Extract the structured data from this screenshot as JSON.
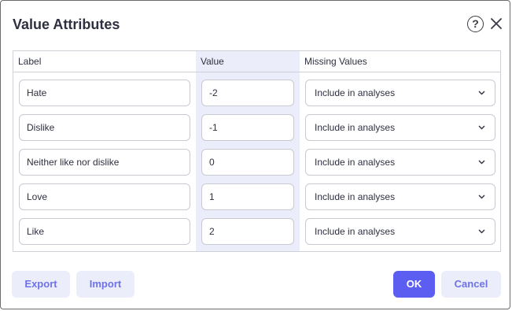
{
  "dialog": {
    "title": "Value Attributes",
    "help_icon_glyph": "?"
  },
  "table": {
    "columns": {
      "label": "Label",
      "value": "Value",
      "missing": "Missing Values"
    },
    "rows": [
      {
        "label": "Hate",
        "value": "-2",
        "missing": "Include in analyses"
      },
      {
        "label": "Dislike",
        "value": "-1",
        "missing": "Include in analyses"
      },
      {
        "label": "Neither like nor dislike",
        "value": "0",
        "missing": "Include in analyses"
      },
      {
        "label": "Love",
        "value": "1",
        "missing": "Include in analyses"
      },
      {
        "label": "Like",
        "value": "2",
        "missing": "Include in analyses"
      }
    ]
  },
  "footer": {
    "export": "Export",
    "import": "Import",
    "ok": "OK",
    "cancel": "Cancel"
  },
  "colors": {
    "primary": "#5b5ef0",
    "secondary_bg": "#ecedfb",
    "secondary_text": "#6e72e8"
  }
}
